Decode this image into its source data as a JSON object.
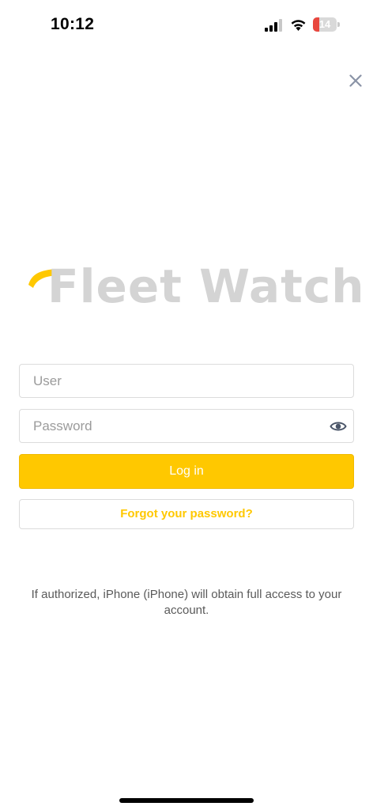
{
  "status_bar": {
    "time": "10:12",
    "battery_level": "14",
    "battery_fraction": 0.14,
    "battery_color": "#e8473e"
  },
  "close": {
    "icon": "close-icon"
  },
  "logo": {
    "text": "Fleet Watch",
    "accent_color": "#ffc800",
    "text_color": "#d4d4d4"
  },
  "form": {
    "user_placeholder": "User",
    "user_value": "",
    "password_placeholder": "Password",
    "password_value": "",
    "toggle_icon": "eye-icon",
    "login_label": "Log in",
    "forgot_label": "Forgot your password?"
  },
  "notice": "If authorized, iPhone (iPhone) will obtain full access to your account.",
  "colors": {
    "accent": "#ffc800",
    "border": "#dcdcdc"
  }
}
